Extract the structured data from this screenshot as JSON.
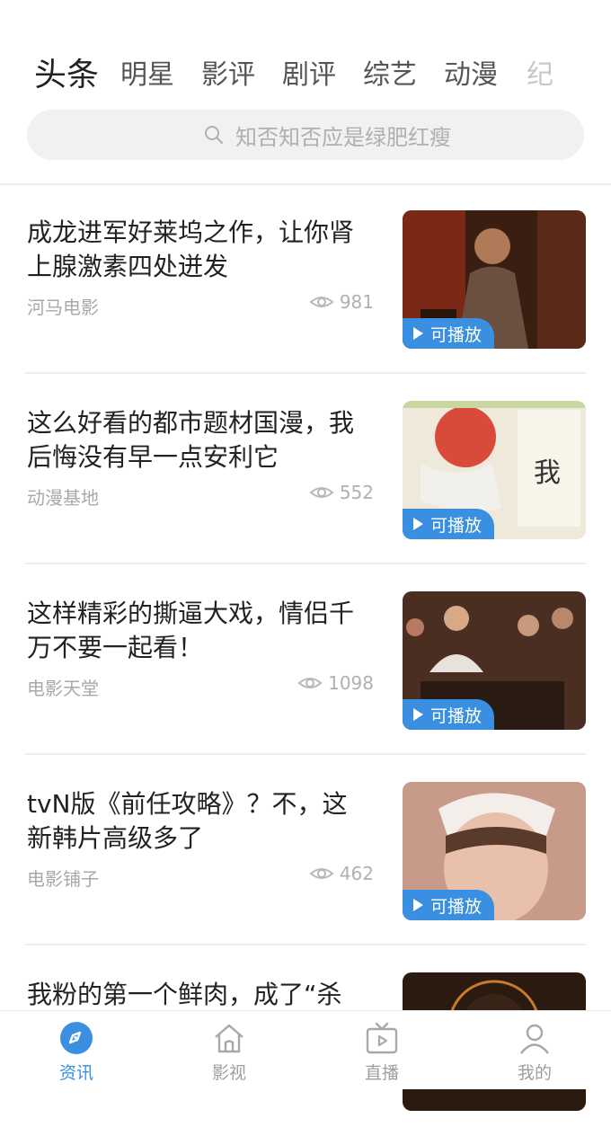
{
  "tabs": [
    "头条",
    "明星",
    "影评",
    "剧评",
    "综艺",
    "动漫",
    "纪"
  ],
  "search": {
    "placeholder": "知否知否应是绿肥红瘦"
  },
  "articles": [
    {
      "title": "成龙进军好莱坞之作，让你肾上腺激素四处迸发",
      "source": "河马电影",
      "views": "981",
      "badge": "可播放"
    },
    {
      "title": "这么好看的都市题材国漫，我后悔没有早一点安利它",
      "source": "动漫基地",
      "views": "552",
      "badge": "可播放"
    },
    {
      "title": "这样精彩的撕逼大戏，情侣千万不要一起看！",
      "source": "电影天堂",
      "views": "1098",
      "badge": "可播放"
    },
    {
      "title": "tvN版《前任攻略》？不，这新韩片高级多了",
      "source": "电影铺子",
      "views": "462",
      "badge": "可播放"
    },
    {
      "title": "我粉的第一个鲜肉，成了“杀"
    }
  ],
  "bottom_nav": [
    {
      "label": "资讯",
      "icon": "news-icon",
      "active": true
    },
    {
      "label": "影视",
      "icon": "home-icon",
      "active": false
    },
    {
      "label": "直播",
      "icon": "tv-icon",
      "active": false
    },
    {
      "label": "我的",
      "icon": "user-icon",
      "active": false
    }
  ],
  "colors": {
    "accent": "#3a8fe0",
    "text": "#222222",
    "muted": "#a9a9a9"
  }
}
